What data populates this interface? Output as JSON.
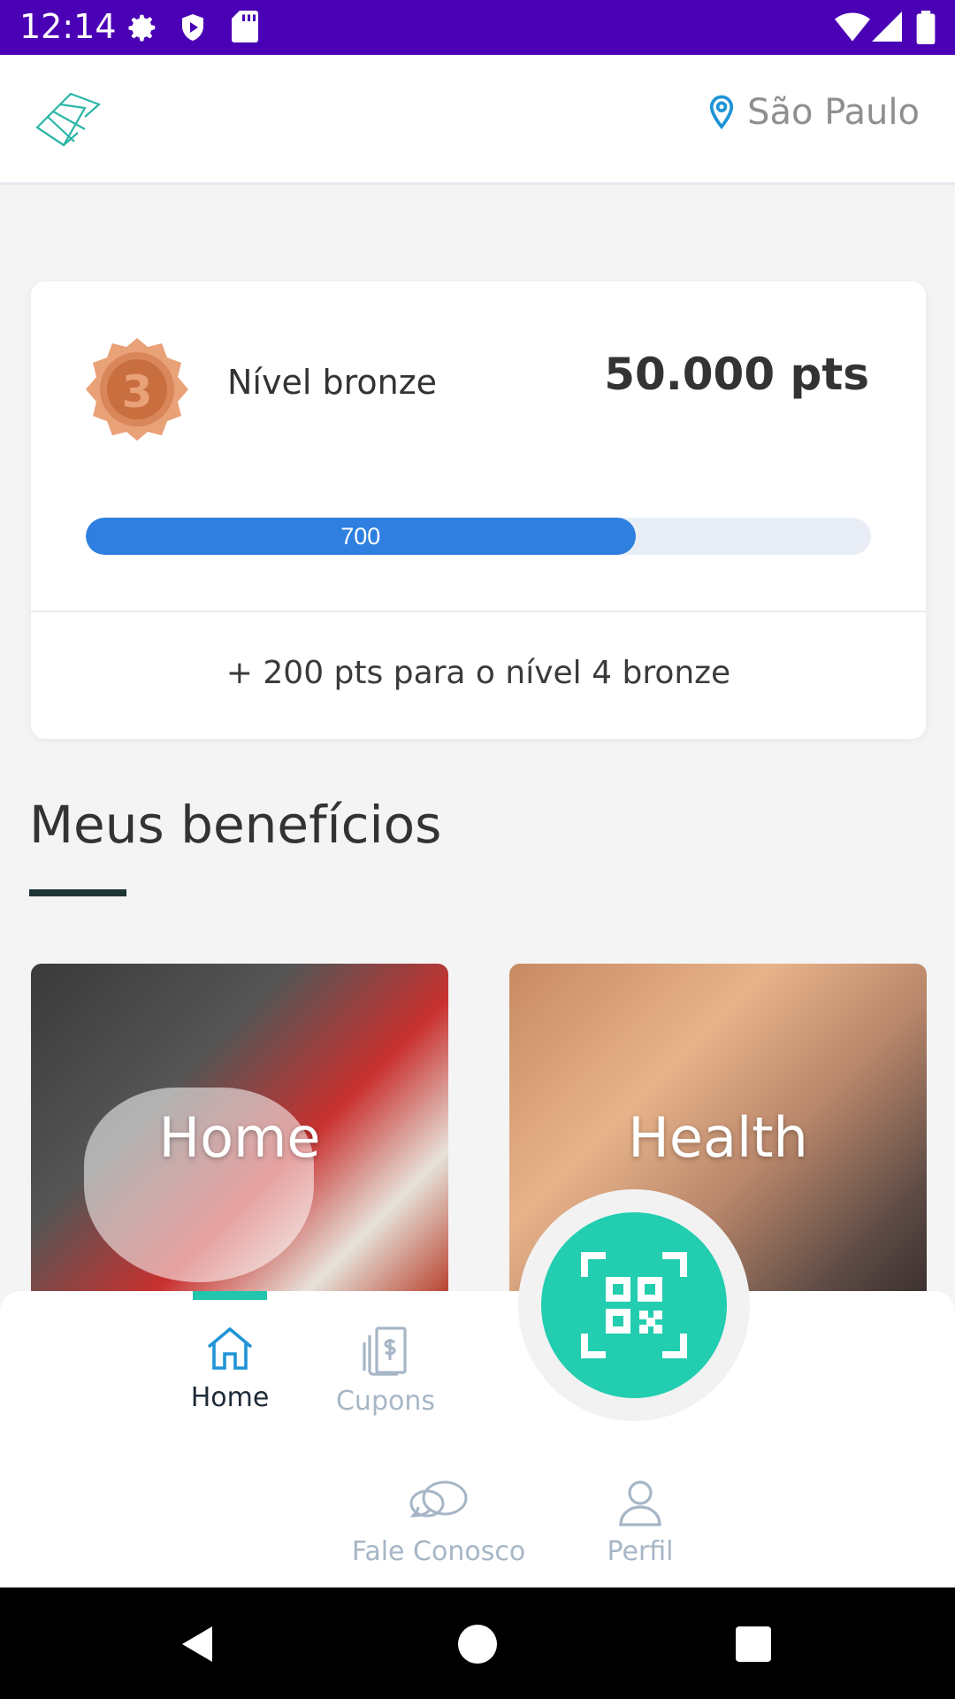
{
  "status_bar": {
    "time": "12:14"
  },
  "header": {
    "location": "São Paulo"
  },
  "level_card": {
    "medal_number": "3",
    "level_label": "Nível bronze",
    "points": "50.000 pts",
    "progress_label": "700",
    "progress_fraction": 0.7,
    "next_level_text": "+ 200 pts para o nível 4 bronze"
  },
  "benefits": {
    "title": "Meus benefícios",
    "tiles": [
      {
        "label": "Home"
      },
      {
        "label": "Health"
      }
    ]
  },
  "bottom_nav": {
    "items": [
      {
        "label": "Home",
        "icon": "home-icon",
        "active": true
      },
      {
        "label": "Cupons",
        "icon": "coupon-icon",
        "active": false
      },
      {
        "label": "Fale Conosco",
        "icon": "chat-icon",
        "active": false
      },
      {
        "label": "Perfil",
        "icon": "user-icon",
        "active": false
      }
    ],
    "center_action": "qr-scan-icon"
  },
  "colors": {
    "status_bar": "#4a00b4",
    "accent": "#22cdb0",
    "progress": "#2e7fe0",
    "medal": "#d9865a"
  }
}
